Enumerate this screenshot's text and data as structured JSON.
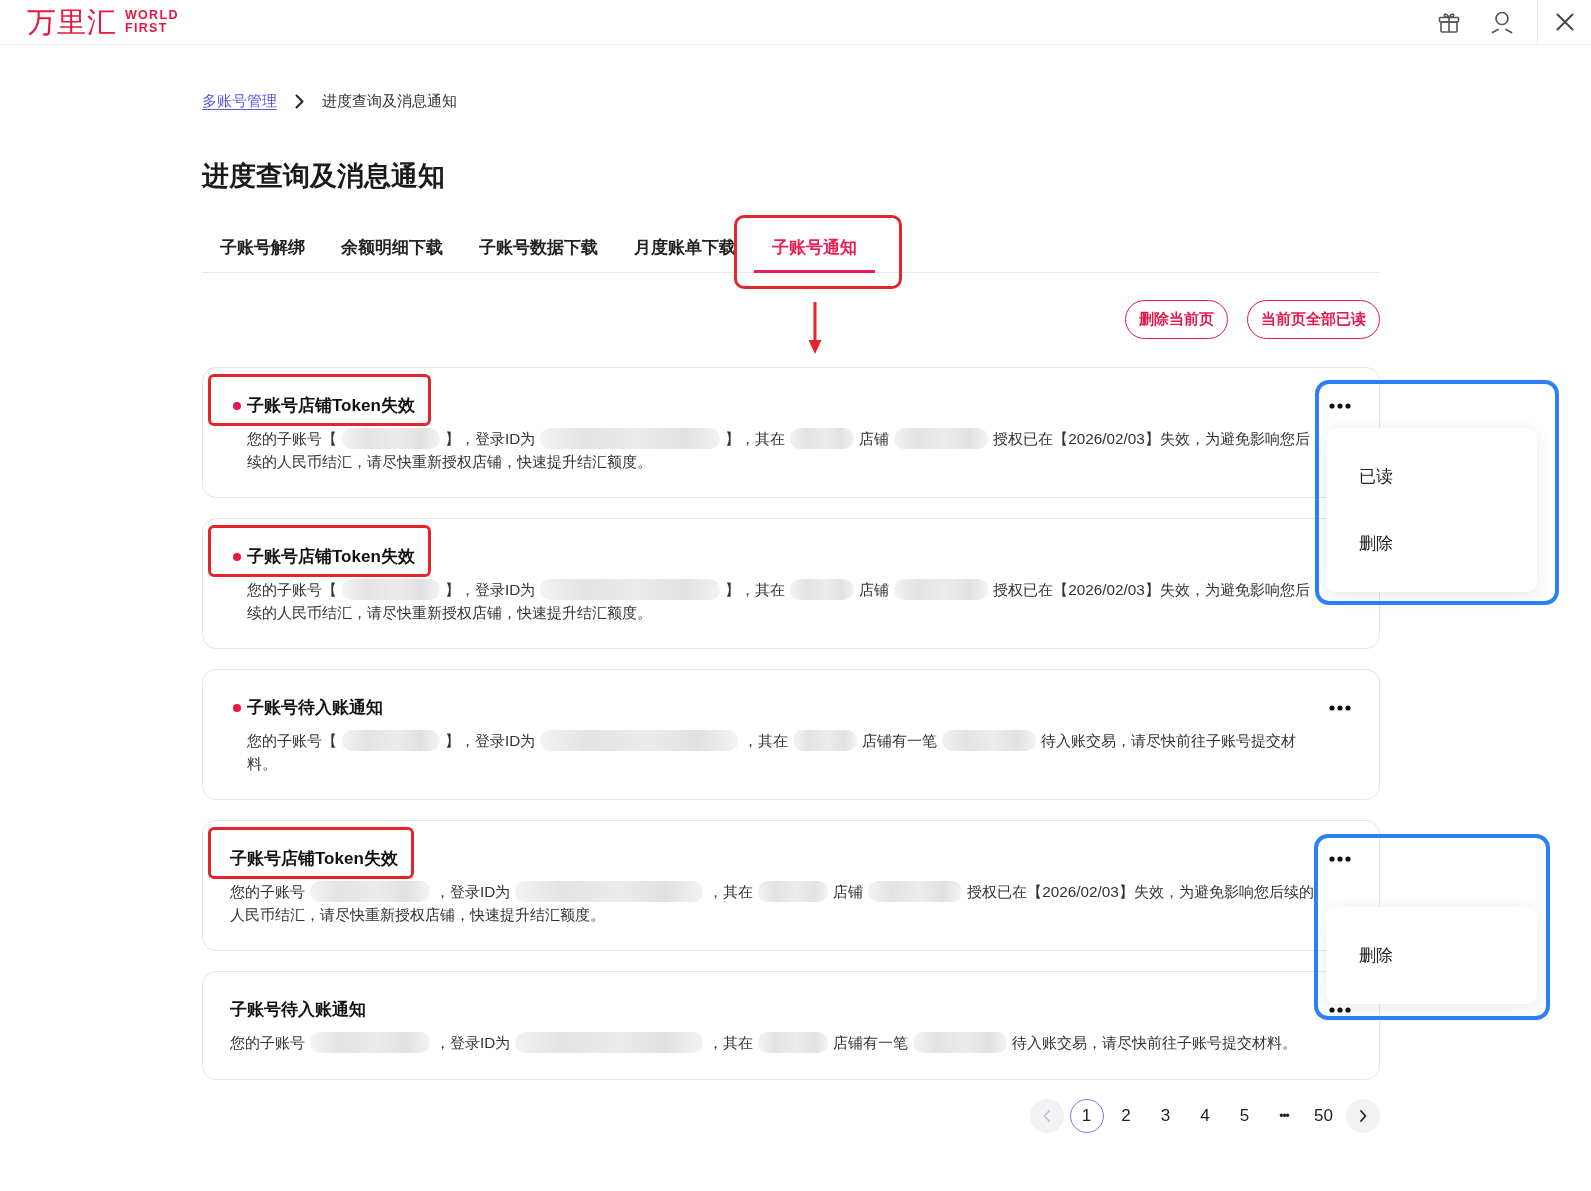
{
  "header": {
    "logo": {
      "name": "万里汇",
      "tagline": [
        "WORLD",
        "FIRST"
      ]
    }
  },
  "breadcrumb": [
    {
      "label": "多账号管理",
      "link": true
    },
    {
      "label": "进度查询及消息通知",
      "link": false
    }
  ],
  "page_title": "进度查询及消息通知",
  "tabs": [
    {
      "label": "子账号解绑",
      "selected": false,
      "annotated": false,
      "annotation_arrow": false
    },
    {
      "label": "余额明细下载",
      "selected": false,
      "annotated": false,
      "annotation_arrow": false
    },
    {
      "label": "子账号数据下载",
      "selected": false,
      "annotated": false,
      "annotation_arrow": false
    },
    {
      "label": "月度账单下载",
      "selected": false,
      "annotated": false,
      "annotation_arrow": false
    },
    {
      "label": "子账号通知",
      "selected": true,
      "annotated": true,
      "annotation_arrow": true
    }
  ],
  "actions": [
    "删除当前页",
    "当前页全部已读"
  ],
  "notices": [
    {
      "title": "子账号店铺Token失效",
      "unread": true,
      "title_annotated": true,
      "message": [
        {
          "kind": "text",
          "text": "您的子账号【"
        },
        {
          "kind": "redacted"
        },
        {
          "kind": "text",
          "text": "】，登录ID为"
        },
        {
          "kind": "redacted"
        },
        {
          "kind": "text",
          "text": "】，其在"
        },
        {
          "kind": "redacted"
        },
        {
          "kind": "text",
          "text": "店铺"
        },
        {
          "kind": "redacted"
        },
        {
          "kind": "text",
          "text": "授权已在【2026/02/03】失效，为避免影响您后续的人民币结汇，请尽快重新授权店铺，快速提升结汇额度。"
        }
      ],
      "menu": {
        "open": true,
        "opens_upward": false,
        "annotated": true,
        "items": [
          "已读",
          "删除"
        ]
      }
    },
    {
      "title": "子账号店铺Token失效",
      "unread": true,
      "title_annotated": true,
      "message": [
        {
          "kind": "text",
          "text": "您的子账号【"
        },
        {
          "kind": "redacted"
        },
        {
          "kind": "text",
          "text": "】，登录ID为"
        },
        {
          "kind": "redacted"
        },
        {
          "kind": "text",
          "text": "】，其在"
        },
        {
          "kind": "redacted"
        },
        {
          "kind": "text",
          "text": "店铺"
        },
        {
          "kind": "redacted"
        },
        {
          "kind": "text",
          "text": "授权已在【2026/02/03】失效，为避免影响您后续的人民币结汇，请尽快重新授权店铺，快速提升结汇额度。"
        }
      ]
    },
    {
      "title": "子账号待入账通知",
      "unread": true,
      "title_annotated": false,
      "message": [
        {
          "kind": "text",
          "text": "您的子账号【"
        },
        {
          "kind": "redacted"
        },
        {
          "kind": "text",
          "text": "】，登录ID为"
        },
        {
          "kind": "redacted"
        },
        {
          "kind": "text",
          "text": "，其在"
        },
        {
          "kind": "redacted"
        },
        {
          "kind": "text",
          "text": "店铺有一笔"
        },
        {
          "kind": "redacted"
        },
        {
          "kind": "text",
          "text": "待入账交易，请尽快前往子账号提交材料。"
        }
      ]
    },
    {
      "title": "子账号店铺Token失效",
      "unread": false,
      "title_annotated": true,
      "message": [
        {
          "kind": "text",
          "text": "您的子账号"
        },
        {
          "kind": "redacted"
        },
        {
          "kind": "text",
          "text": "，登录ID为"
        },
        {
          "kind": "redacted"
        },
        {
          "kind": "text",
          "text": "，其在"
        },
        {
          "kind": "redacted"
        },
        {
          "kind": "text",
          "text": "店铺"
        },
        {
          "kind": "redacted"
        },
        {
          "kind": "text",
          "text": "授权已在【2026/02/03】失效，为避免影响您后续的人民币结汇，请尽快重新授权店铺，快速提升结汇额度。"
        }
      ]
    },
    {
      "title": "子账号待入账通知",
      "unread": false,
      "title_annotated": false,
      "message": [
        {
          "kind": "text",
          "text": "您的子账号"
        },
        {
          "kind": "redacted"
        },
        {
          "kind": "text",
          "text": "，登录ID为"
        },
        {
          "kind": "redacted"
        },
        {
          "kind": "text",
          "text": "，其在"
        },
        {
          "kind": "redacted"
        },
        {
          "kind": "text",
          "text": "店铺有一笔"
        },
        {
          "kind": "redacted"
        },
        {
          "kind": "text",
          "text": "待入账交易，请尽快前往子账号提交材料。"
        }
      ],
      "menu": {
        "open": true,
        "opens_upward": true,
        "annotated": true,
        "items": [
          "删除"
        ]
      }
    }
  ],
  "pagination": {
    "previous": {
      "disabled": true
    },
    "next": {
      "disabled": false
    },
    "pages": [
      {
        "kind": "page",
        "label": "1",
        "selected": true
      },
      {
        "kind": "page",
        "label": "2",
        "selected": false
      },
      {
        "kind": "page",
        "label": "3",
        "selected": false
      },
      {
        "kind": "page",
        "label": "4",
        "selected": false
      },
      {
        "kind": "page",
        "label": "5",
        "selected": false
      },
      {
        "kind": "ellipsis",
        "label": "•••",
        "selected": false
      },
      {
        "kind": "page",
        "label": "50",
        "selected": false
      }
    ]
  }
}
